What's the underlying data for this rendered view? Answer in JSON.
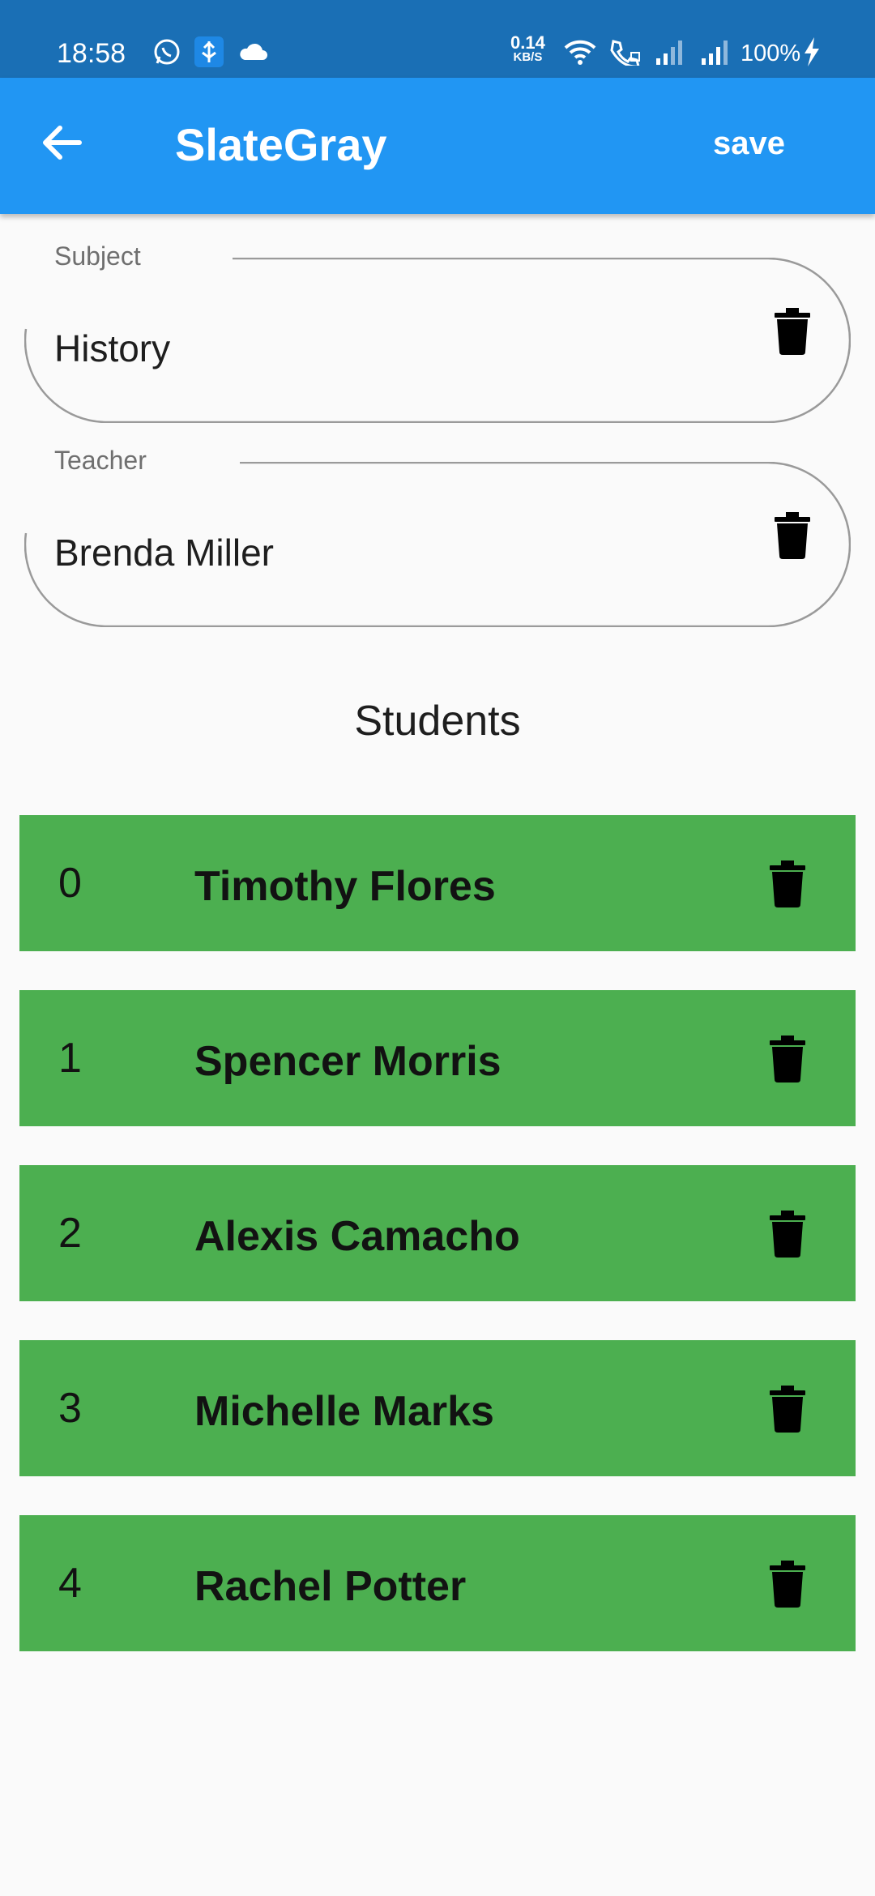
{
  "status_bar": {
    "time": "18:58",
    "speed_value": "0.14",
    "speed_unit": "KB/S",
    "battery": "100%",
    "icons": [
      "whatsapp-icon",
      "usb-icon",
      "cloud-icon",
      "wifi-icon",
      "wifi-call-icon",
      "signal-icon",
      "signal-icon",
      "charging-icon"
    ]
  },
  "app_bar": {
    "title": "SlateGray",
    "save_label": "save",
    "back_icon": "arrow-back-icon",
    "background": "#2196f3"
  },
  "fields": {
    "subject": {
      "label": "Subject",
      "value": "History"
    },
    "teacher": {
      "label": "Teacher",
      "value": "Brenda Miller"
    }
  },
  "students_title": "Students",
  "students": [
    {
      "index": "0",
      "name": "Timothy Flores"
    },
    {
      "index": "1",
      "name": "Spencer Morris"
    },
    {
      "index": "2",
      "name": "Alexis Camacho"
    },
    {
      "index": "3",
      "name": "Michelle Marks"
    },
    {
      "index": "4",
      "name": "Rachel Potter"
    }
  ],
  "colors": {
    "row_background": "#4caf50",
    "status_bar": "#1a6fb5"
  }
}
